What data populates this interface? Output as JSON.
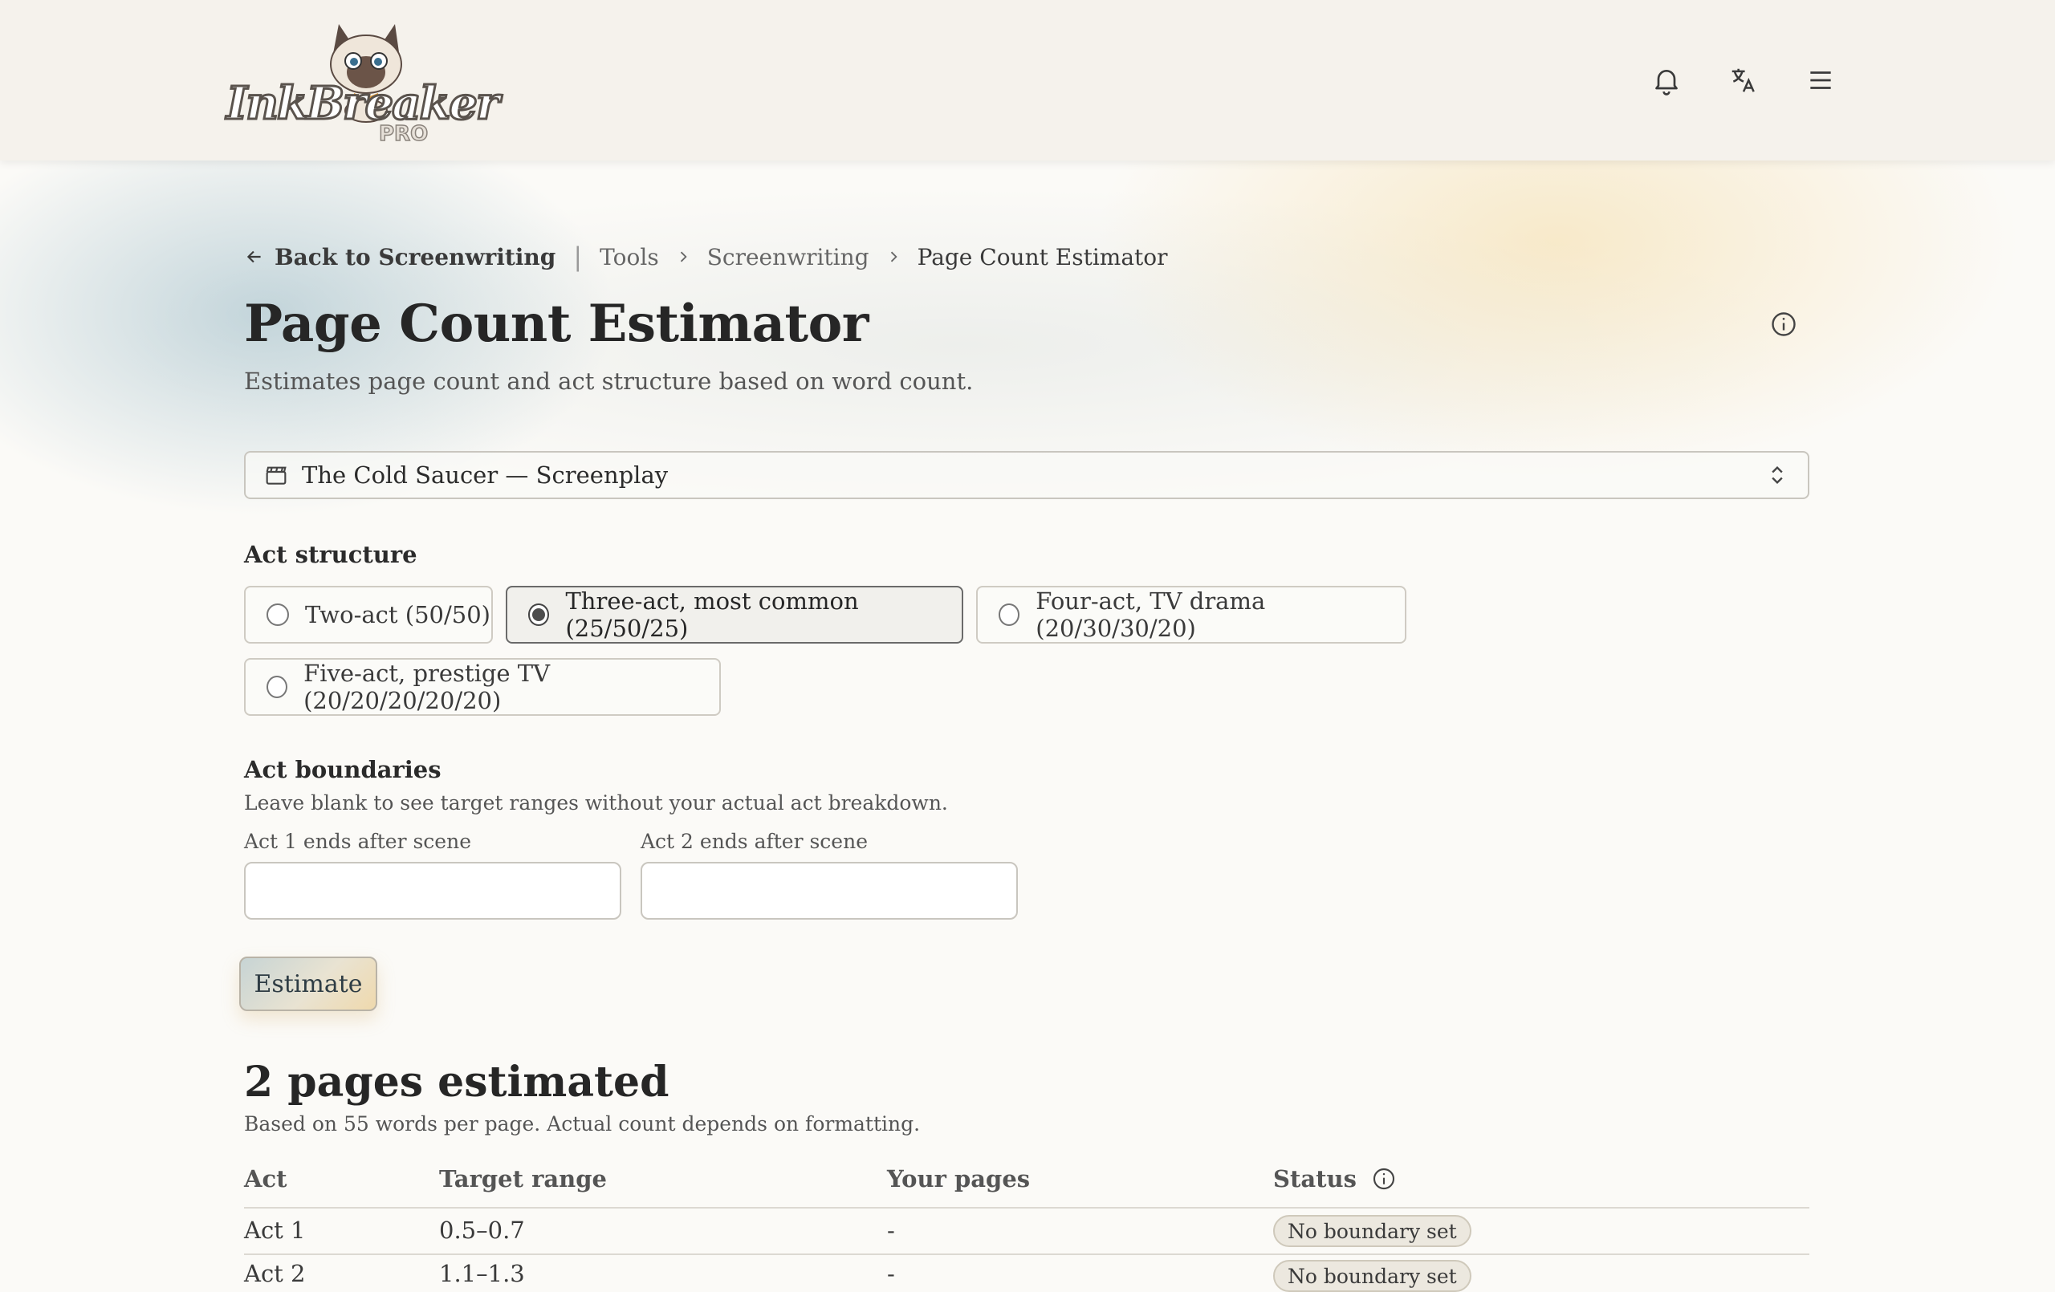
{
  "header": {
    "logo_text": "InkBreaker",
    "logo_sub": "PRO",
    "icons": [
      "bell-icon",
      "translate-icon",
      "menu-icon"
    ]
  },
  "breadcrumb": {
    "back_label": "Back to Screenwriting",
    "separator": "|",
    "items": [
      "Tools",
      "Screenwriting",
      "Page Count Estimator"
    ]
  },
  "page": {
    "title": "Page Count Estimator",
    "subtitle": "Estimates page count and act structure based on word count."
  },
  "project_select": {
    "value": "The Cold Saucer — Screenplay"
  },
  "act_structure": {
    "label": "Act structure",
    "options": [
      {
        "label": "Two-act (50/50)",
        "selected": false
      },
      {
        "label": "Three-act, most common (25/50/25)",
        "selected": true
      },
      {
        "label": "Four-act, TV drama (20/30/30/20)",
        "selected": false
      },
      {
        "label": "Five-act, prestige TV (20/20/20/20/20)",
        "selected": false
      }
    ]
  },
  "boundaries": {
    "label": "Act boundaries",
    "help": "Leave blank to see target ranges without your actual act breakdown.",
    "act1_label": "Act 1 ends after scene",
    "act2_label": "Act 2 ends after scene",
    "act1_value": "",
    "act2_value": ""
  },
  "actions": {
    "estimate_label": "Estimate"
  },
  "result": {
    "title": "2 pages estimated",
    "note": "Based on 55 words per page. Actual count depends on formatting.",
    "columns": [
      "Act",
      "Target range",
      "Your pages",
      "Status"
    ],
    "rows": [
      {
        "act": "Act 1",
        "target": "0.5–0.7",
        "pages": "-",
        "status": "No boundary set"
      },
      {
        "act": "Act 2",
        "target": "1.1–1.3",
        "pages": "-",
        "status": "No boundary set"
      }
    ]
  },
  "colors": {
    "accent_blue": "#96b7c4",
    "accent_gold": "#f5dca5",
    "text": "#2b2b2b"
  }
}
